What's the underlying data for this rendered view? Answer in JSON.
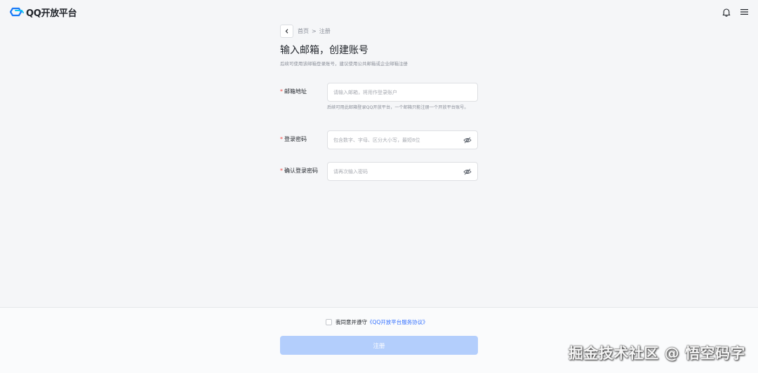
{
  "header": {
    "brand": "QQ开放平台"
  },
  "breadcrumb": {
    "home": "首页",
    "separator": ">",
    "current": "注册"
  },
  "page": {
    "title": "输入邮箱，创建账号",
    "subtitle": "后续可使用该邮箱登录账号，建议使用公共邮箱或企业邮箱注册"
  },
  "form": {
    "email": {
      "required_mark": "*",
      "label": "邮箱地址",
      "placeholder": "请输入邮箱，将用作登录账户",
      "value": "",
      "hint": "后续可用此邮箱登录QQ开放平台，一个邮箱只能注册一个开放平台账号。"
    },
    "password": {
      "required_mark": "*",
      "label": "登录密码",
      "placeholder": "包含数字、字母、区分大小写，最短8位",
      "value": ""
    },
    "confirm_password": {
      "required_mark": "*",
      "label": "确认登录密码",
      "placeholder": "请再次输入密码",
      "value": ""
    }
  },
  "footer": {
    "agree_text": "我同意并遵守",
    "agree_link": "《QQ开放平台服务协议》",
    "submit_label": "注册"
  },
  "watermark": "掘金技术社区 @ 悟空码字",
  "colors": {
    "accent": "#3370ff",
    "submit_disabled": "#b3cefc",
    "required": "#f54a45",
    "background": "#f5f6f8"
  },
  "icons": {
    "logo": "qq-open-platform-logo",
    "bell": "bell-icon",
    "menu": "menu-icon",
    "back": "chevron-left-icon",
    "eye": "eye-off-icon"
  }
}
